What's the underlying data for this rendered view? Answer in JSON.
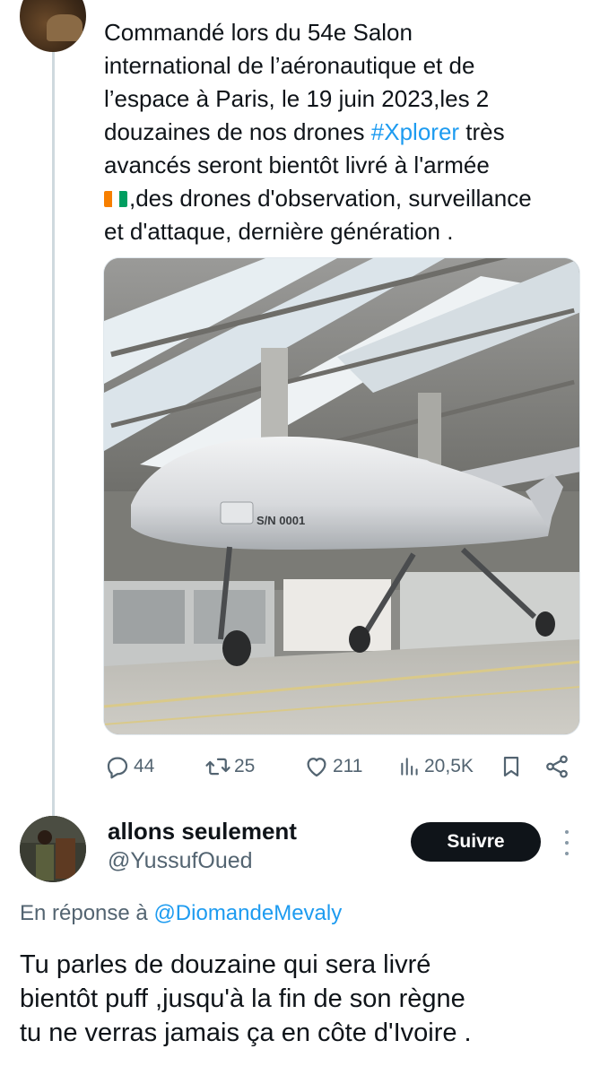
{
  "original_tweet": {
    "text_lines": [
      "Commandé lors du 54e Salon",
      "international de l’aéronautique et de",
      "l’espace à  Paris, le 19 juin 2023,les 2",
      "douzaines de nos drones ",
      " très",
      "avancés seront bientôt livré à l'armée",
      ",des drones d'observation, surveillance",
      "et d'attaque, dernière génération ."
    ],
    "hashtag": "#Xplorer",
    "flag_colors": [
      "#f77f00",
      "#ffffff",
      "#009e60"
    ],
    "media": {
      "serial_label": "S/N 0001"
    },
    "actions": {
      "reply_count": "44",
      "retweet_count": "25",
      "like_count": "211",
      "views_count": "20,5K"
    }
  },
  "reply_tweet": {
    "display_name": "allons seulement",
    "handle": "@YussufOued",
    "follow_label": "Suivre",
    "reply_prefix": "En réponse à ",
    "reply_mention": "@DiomandeMevaly",
    "text_lines": [
      "Tu parles de douzaine qui sera  livré",
      "bientôt puff  ,jusqu'à la fin de son règne",
      "tu ne verras jamais ça  en côte d'Ivoire  ."
    ]
  },
  "colors": {
    "accent": "#1d9bf0",
    "muted": "#536471",
    "text": "#0f1419"
  }
}
